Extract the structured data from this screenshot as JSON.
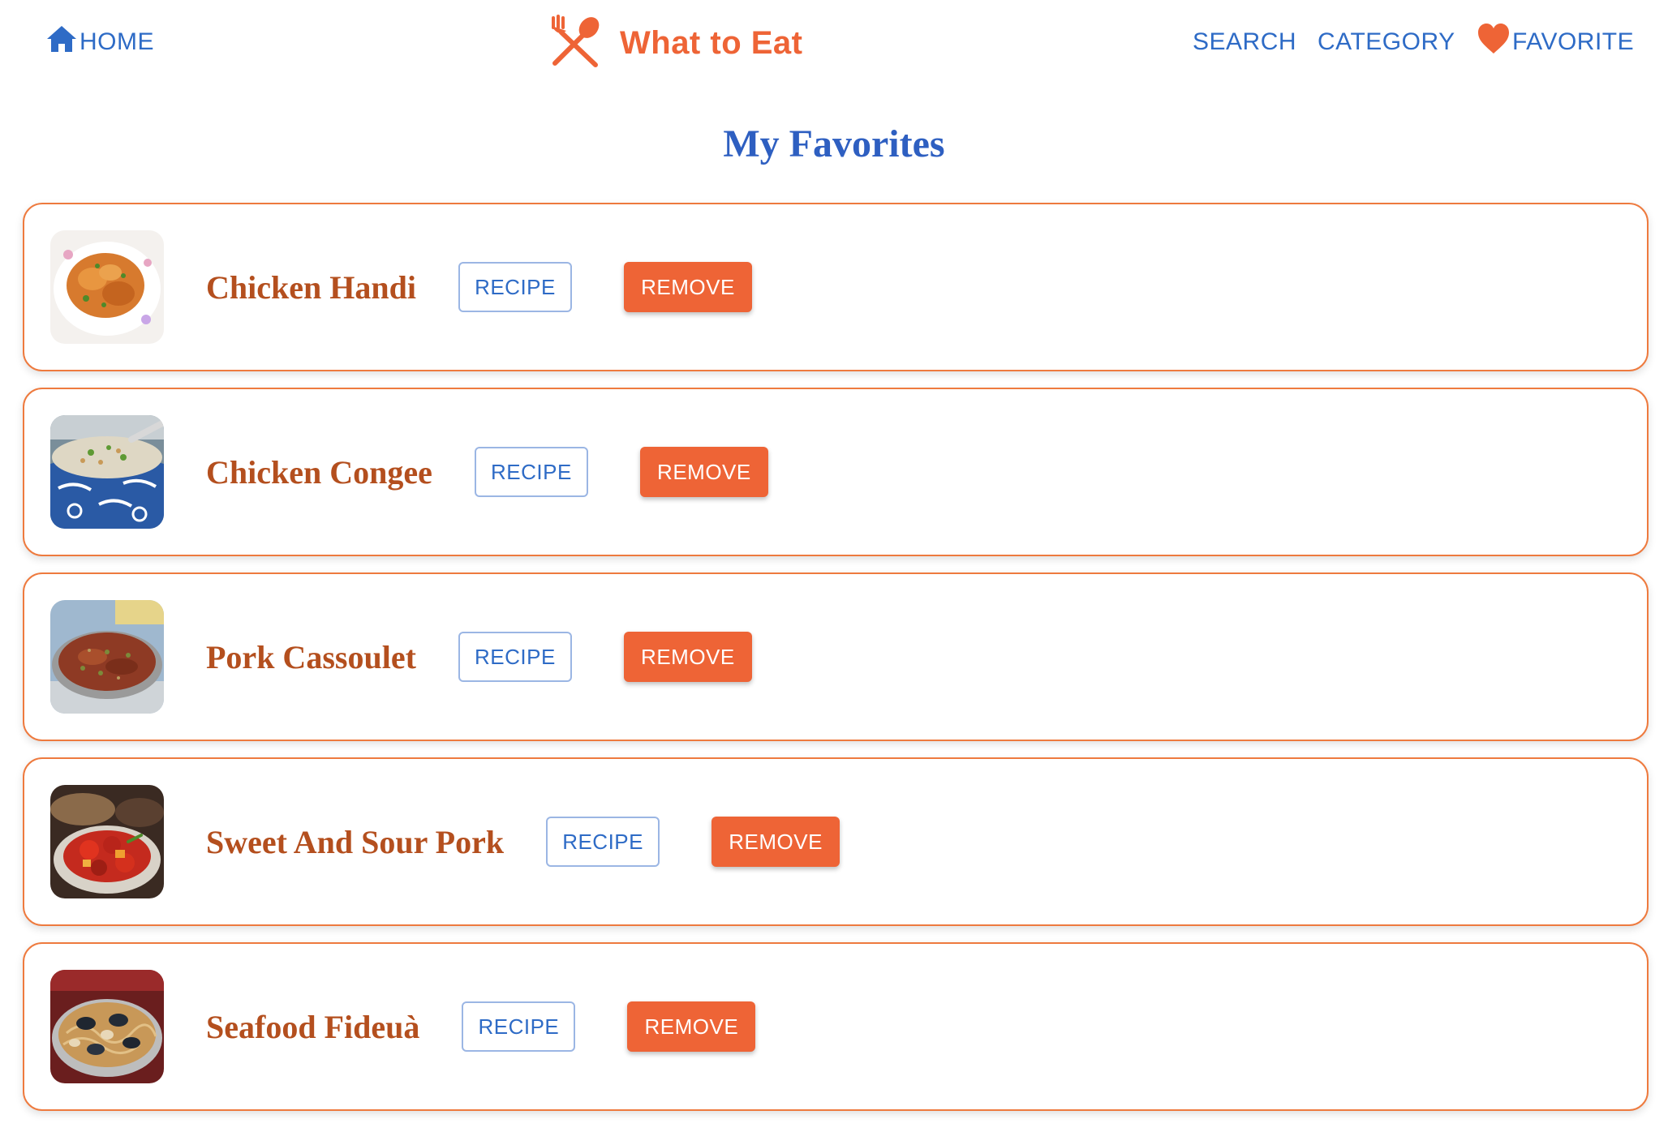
{
  "nav": {
    "home_label": "HOME",
    "search_label": "SEARCH",
    "category_label": "CATEGORY",
    "favorite_label": "FAVORITE"
  },
  "brand": {
    "name": "What to Eat",
    "icon": "fork-spoon-icon"
  },
  "page": {
    "title": "My Favorites"
  },
  "favorites": [
    {
      "name": "Chicken Handi",
      "recipe_label": "RECIPE",
      "remove_label": "REMOVE"
    },
    {
      "name": "Chicken Congee",
      "recipe_label": "RECIPE",
      "remove_label": "REMOVE"
    },
    {
      "name": "Pork Cassoulet",
      "recipe_label": "RECIPE",
      "remove_label": "REMOVE"
    },
    {
      "name": "Sweet And Sour Pork",
      "recipe_label": "RECIPE",
      "remove_label": "REMOVE"
    },
    {
      "name": "Seafood Fideuà",
      "recipe_label": "RECIPE",
      "remove_label": "REMOVE"
    }
  ],
  "colors": {
    "accent": "#ee6436",
    "link_blue": "#2e6bc6",
    "title_blue": "#2e5fc1",
    "dish_name": "#b44f1e",
    "card_border": "#ee7a3e"
  },
  "icons": {
    "home": "home-icon",
    "favorite": "heart-icon"
  }
}
